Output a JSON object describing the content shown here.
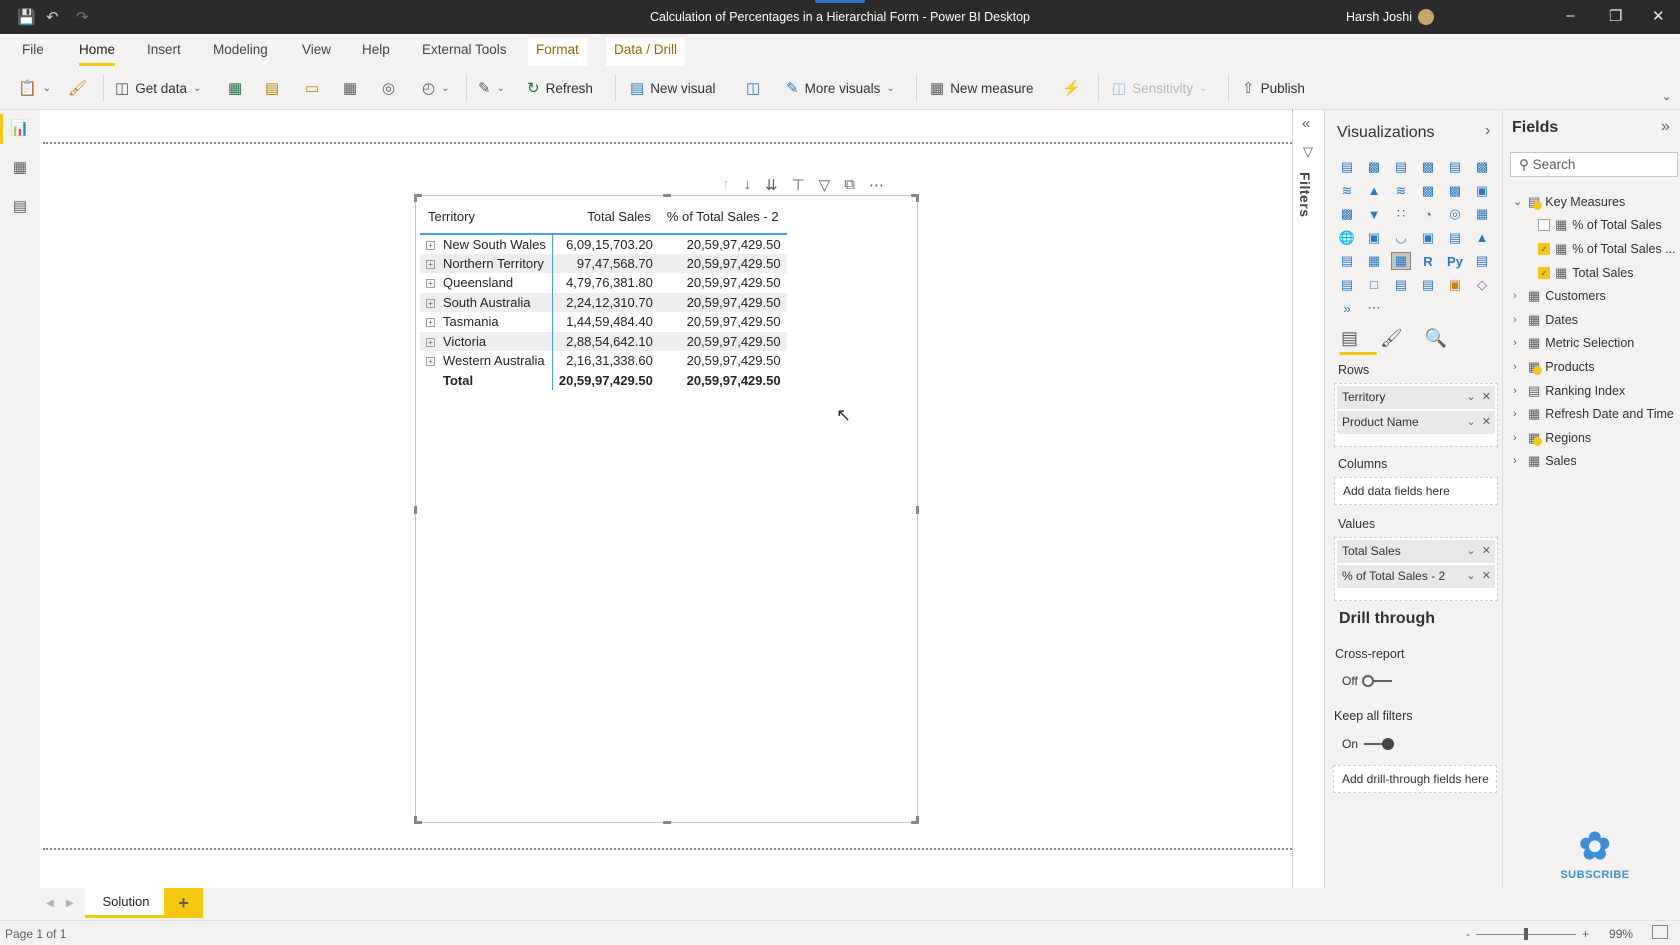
{
  "titlebar": {
    "title": "Calculation of Percentages in a Hierarchial Form - Power BI Desktop",
    "user": "Harsh Joshi"
  },
  "menu": {
    "items": [
      "File",
      "Home",
      "Insert",
      "Modeling",
      "View",
      "Help",
      "External Tools",
      "Format",
      "Data / Drill"
    ],
    "active": "Home"
  },
  "ribbon": {
    "get_data": "Get data",
    "refresh": "Refresh",
    "new_visual": "New visual",
    "more_visuals": "More visuals",
    "new_measure": "New measure",
    "sensitivity": "Sensitivity",
    "publish": "Publish"
  },
  "matrix": {
    "headers": [
      "Territory",
      "Total Sales",
      "% of Total Sales - 2"
    ],
    "rows": [
      {
        "territory": "New South Wales",
        "total_sales": "6,09,15,703.20",
        "pct": "20,59,97,429.50"
      },
      {
        "territory": "Northern Territory",
        "total_sales": "97,47,568.70",
        "pct": "20,59,97,429.50"
      },
      {
        "territory": "Queensland",
        "total_sales": "4,79,76,381.80",
        "pct": "20,59,97,429.50"
      },
      {
        "territory": "South Australia",
        "total_sales": "2,24,12,310.70",
        "pct": "20,59,97,429.50"
      },
      {
        "territory": "Tasmania",
        "total_sales": "1,44,59,484.40",
        "pct": "20,59,97,429.50"
      },
      {
        "territory": "Victoria",
        "total_sales": "2,88,54,642.10",
        "pct": "20,59,97,429.50"
      },
      {
        "territory": "Western Australia",
        "total_sales": "2,16,31,338.60",
        "pct": "20,59,97,429.50"
      }
    ],
    "total": {
      "label": "Total",
      "total_sales": "20,59,97,429.50",
      "pct": "20,59,97,429.50"
    }
  },
  "filters": {
    "label": "Filters"
  },
  "visualizations": {
    "title": "Visualizations",
    "rows_label": "Rows",
    "rows": [
      "Territory",
      "Product Name"
    ],
    "columns_label": "Columns",
    "columns_placeholder": "Add data fields here",
    "values_label": "Values",
    "values": [
      "Total Sales",
      "% of Total Sales - 2"
    ],
    "drill_title": "Drill through",
    "cross_report_label": "Cross-report",
    "cross_report_state": "Off",
    "keep_filters_label": "Keep all filters",
    "keep_filters_state": "On",
    "drill_placeholder": "Add drill-through fields here"
  },
  "fields": {
    "title": "Fields",
    "search_placeholder": "Search",
    "key_measures": {
      "name": "Key Measures",
      "items": [
        {
          "name": "% of Total Sales",
          "checked": false
        },
        {
          "name": "% of Total Sales ...",
          "checked": true
        },
        {
          "name": "Total Sales",
          "checked": true
        }
      ]
    },
    "tables": [
      "Customers",
      "Dates",
      "Metric Selection",
      "Products",
      "Ranking Index",
      "Refresh Date and Time",
      "Regions",
      "Sales"
    ]
  },
  "pages": {
    "tabs": [
      "Solution"
    ],
    "status": "Page 1 of 1"
  },
  "zoom": {
    "level": "99%"
  },
  "branding": {
    "subscribe": "SUBSCRIBE"
  }
}
